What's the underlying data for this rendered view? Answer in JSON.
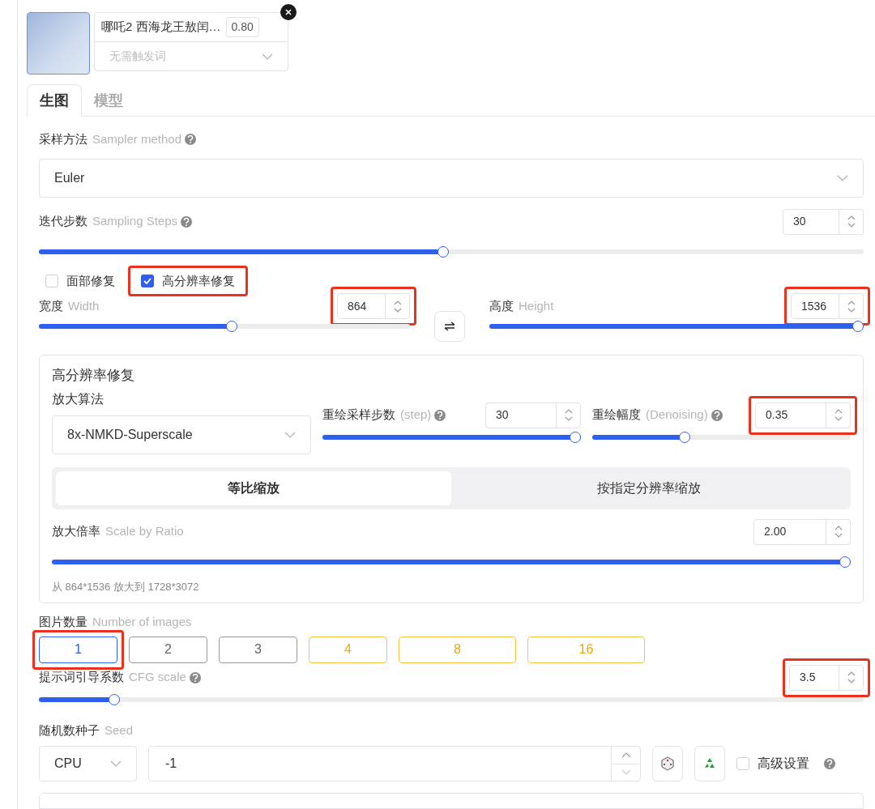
{
  "lora": {
    "name": "哪吒2 西海龙王敖闰…",
    "weight": "0.80",
    "trigger_placeholder": "无需触发词"
  },
  "tabs": [
    {
      "label": "生图",
      "selected": true
    },
    {
      "label": "模型",
      "selected": false
    }
  ],
  "sampler": {
    "label": "采样方法",
    "hint": "Sampler method",
    "value": "Euler"
  },
  "steps": {
    "label": "迭代步数",
    "hint": "Sampling Steps",
    "value": "30",
    "level": 0.49,
    "highlighted": false
  },
  "options": [
    {
      "label": "面部修复",
      "checked": false,
      "highlighted": false
    },
    {
      "label": "高分辨率修复",
      "checked": true,
      "highlighted": true
    }
  ],
  "width": {
    "label": "宽度",
    "hint": "Width",
    "value": "864",
    "level": 0.52,
    "highlighted": true
  },
  "height": {
    "label": "高度",
    "hint": "Height",
    "value": "1536",
    "level": 1,
    "highlighted": true
  },
  "hires": {
    "title": "高分辨率修复",
    "upscaler": {
      "label": "放大算法",
      "value": "8x-NMKD-Superscale"
    },
    "hr_steps": {
      "label": "重绘采样步数",
      "hint": "(step)",
      "value": "30",
      "level": 1,
      "highlighted": false
    },
    "denoise": {
      "label": "重绘幅度",
      "hint": "(Denoising)",
      "value": "0.35",
      "level": 0.35,
      "highlighted": true
    },
    "modes": [
      {
        "label": "等比缩放",
        "selected": true
      },
      {
        "label": "按指定分辨率缩放",
        "selected": false
      }
    ],
    "scale": {
      "label": "放大倍率",
      "hint": "Scale by Ratio",
      "value": "2.00",
      "level": 1,
      "highlighted": false
    },
    "note": "从 864*1536 放大到 1728*3072"
  },
  "images": {
    "label": "图片数量",
    "hint": "Number of images",
    "options": [
      {
        "label": "1",
        "selected": true,
        "kind": "standard",
        "highlighted": true
      },
      {
        "label": "2",
        "selected": false,
        "kind": "standard",
        "highlighted": false
      },
      {
        "label": "3",
        "selected": false,
        "kind": "standard",
        "highlighted": false
      },
      {
        "label": "4",
        "selected": false,
        "kind": "premium",
        "highlighted": false
      },
      {
        "label": "8",
        "selected": false,
        "kind": "premium",
        "highlighted": false
      },
      {
        "label": "16",
        "selected": false,
        "kind": "premium",
        "highlighted": false
      }
    ]
  },
  "cfg": {
    "label": "提示词引导系数",
    "hint": "CFG scale",
    "value": "3.5",
    "level": 0.086,
    "highlighted": true
  },
  "seed": {
    "label": "随机数种子",
    "hint": "Seed",
    "device": "CPU",
    "value": "-1"
  },
  "advanced": {
    "label": "高级设置",
    "checked": false
  }
}
